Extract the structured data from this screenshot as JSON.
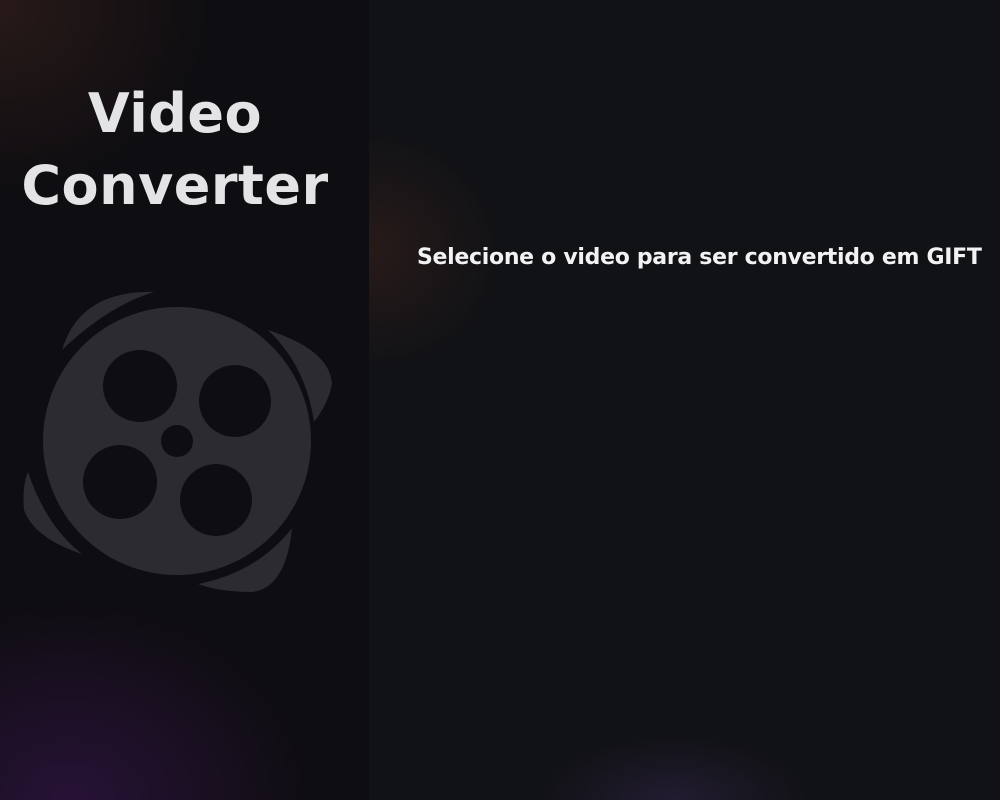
{
  "sidebar": {
    "title_line1": "Video",
    "title_line2": "Converter",
    "logo_icon": "film-reel-icon"
  },
  "main": {
    "prompt": "Selecione o video para ser convertido em GIFT"
  },
  "colors": {
    "background": "#111216",
    "sidebar_background": "#0e0d11",
    "title_text": "#e4e4e6",
    "prompt_text": "#f2f2f4",
    "logo": "#2c2c30"
  }
}
